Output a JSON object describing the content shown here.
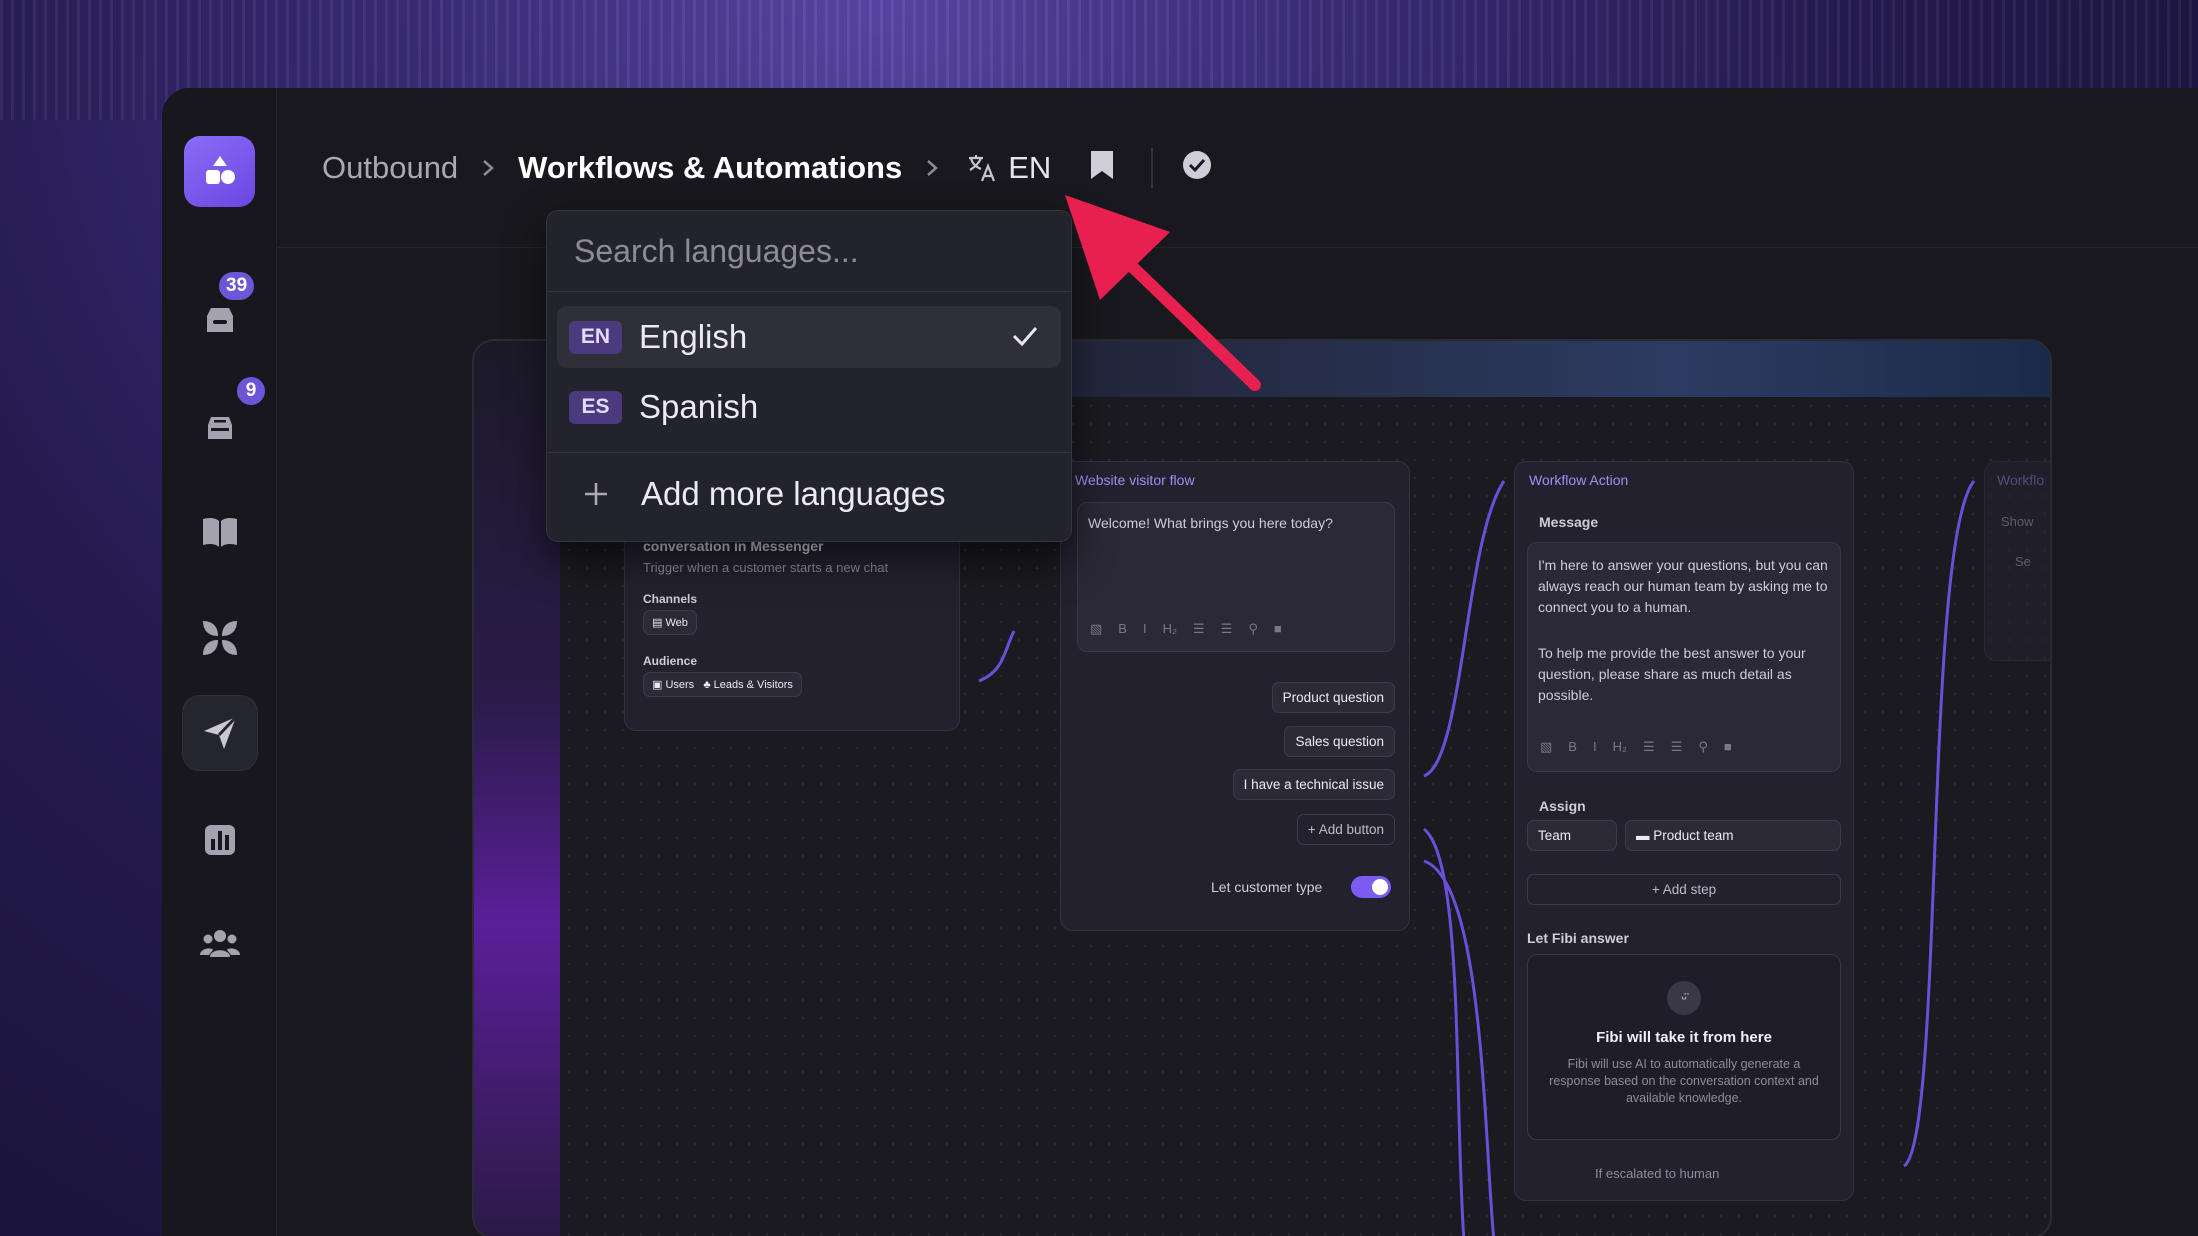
{
  "breadcrumb": {
    "items": [
      "Outbound",
      "Workflows & Automations"
    ],
    "language_code": "EN"
  },
  "sidebar": {
    "badges": {
      "inbox": "39",
      "tickets": "9"
    },
    "items": [
      "logo-icon",
      "inbox-icon",
      "tickets-icon",
      "knowledge-book-icon",
      "apps-icon",
      "outbound-send-icon",
      "reports-icon",
      "contacts-icon"
    ]
  },
  "language_dropdown": {
    "search_placeholder": "Search languages...",
    "languages": [
      {
        "code": "EN",
        "name": "English",
        "selected": true
      },
      {
        "code": "ES",
        "name": "Spanish",
        "selected": false
      }
    ],
    "add_label": "Add more languages"
  },
  "canvas": {
    "trigger_card": {
      "title": "conversation in Messenger",
      "description": "Trigger when a customer starts a new chat",
      "channels_label": "Channels",
      "channel": "Web",
      "audience_label": "Audience",
      "audience": [
        "Users",
        "Leads & Visitors"
      ]
    },
    "visitor_flow": {
      "title": "Website visitor flow",
      "message": "Welcome! What brings you here today?",
      "buttons": [
        "Product question",
        "Sales question",
        "I have a technical issue"
      ],
      "add_button": "Add button",
      "let_type_label": "Let customer type"
    },
    "workflow_action": {
      "title": "Workflow Action",
      "message_label": "Message",
      "message_text_1": "I'm here to answer your questions, but you can always reach our human team by asking me to connect you to a human.",
      "message_text_2": "To help me provide the best answer to your question, please share as much detail as possible.",
      "assign_label": "Assign",
      "assign_type": "Team",
      "assign_team": "Product team",
      "add_step": "Add step",
      "fibi_label": "Let Fibi answer",
      "fibi_title": "Fibi will take it from here",
      "fibi_desc": "Fibi will use AI to automatically generate a response based on the conversation context and available knowledge.",
      "escalate_label": "If escalated to human"
    },
    "partial_card": {
      "title": "Workflo",
      "row1": "Show",
      "row2": "Se"
    }
  },
  "colors": {
    "accent": "#7c5cf0",
    "annotation_arrow": "#e8204f"
  }
}
